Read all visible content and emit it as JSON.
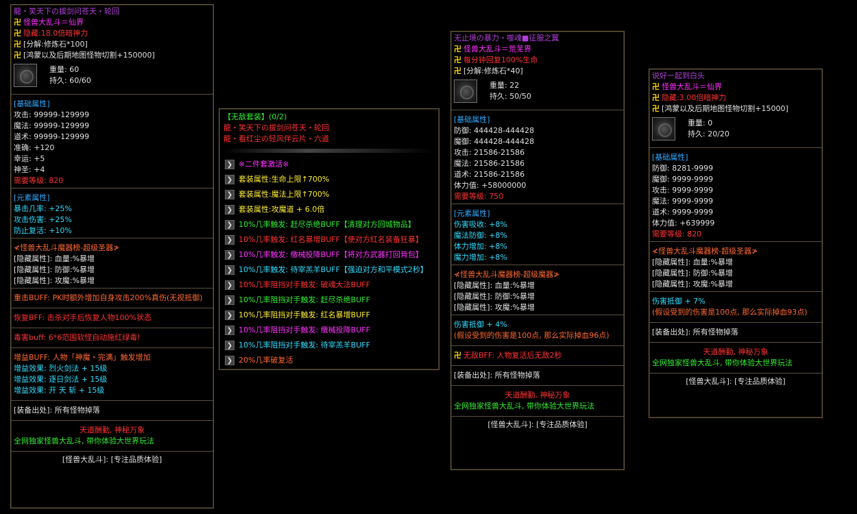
{
  "panel1": {
    "title": "龍・笑天下の拔剑问苍天・轮回",
    "head_rows": [
      {
        "sym": "卍",
        "text": "怪兽大乱斗＝仙界",
        "color": "c-mag"
      },
      {
        "sym": "卍",
        "text": "隐藏:18.0倍暗神力",
        "color": "c-red"
      },
      {
        "sym": "卍",
        "text": "[分解:修炼石*100]",
        "color": "c-white"
      },
      {
        "sym": "卍",
        "text": "[鸿蒙以及后期地图怪物切割+150000]",
        "color": "c-white"
      }
    ],
    "weight": "重量: 60",
    "durability": "持久: 60/60",
    "base_header": "[基础属性]",
    "base_rows": [
      "攻击: 99999-129999",
      "魔法: 99999-129999",
      "道术: 99999-129999",
      "准确: +120",
      "幸运: +5",
      "神圣: +4"
    ],
    "level_req": "需要等级: 820",
    "elem_header": "[元素属性]",
    "elem_rows": [
      "暴击几率: +25%",
      "攻击伤害: +25%",
      "防止复活: +10%"
    ],
    "saint_title": "≮怪兽大乱斗魔器榜-超级圣器≯",
    "hidden_rows": [
      "[隐藏属性]: 血量:%暴增",
      "[隐藏属性]: 防御:%暴增",
      "[隐藏属性]: 攻魔:%暴增"
    ],
    "buff1": "重击BUFF: PK时额外增加自身攻击200%真伤(无视抵御)",
    "buff2": "恢复BFF: 击杀对手后恢复人物100%状态",
    "buff3": "毒害buff: 6*6范围软怪自动施红绿毒!",
    "gain_title": "增益BUFF: 人物「神魔・完满」触发增加",
    "gain_rows": [
      "增益效果: 烈火剑法 + 15级",
      "增益效果: 逐日剑法 + 15级",
      "增益效果: 开 天 斩 + 15级"
    ],
    "source": "[装备出处]: 所有怪物掉落",
    "slogan1": "天道酬勤, 神秘万象",
    "slogan2": "全网独家怪兽大乱斗, 带你体验大世界玩法",
    "footer": "[怪兽大乱斗]: [专注品质体验]"
  },
  "panel2": {
    "set_title": "【无敌套装】(0/2)",
    "set_items": [
      "龍・笑天下の拔剑问苍天・轮回",
      "龍・看红尘の轻风伴云片・六道"
    ],
    "rows": [
      {
        "text": "※二件套激活※",
        "color": "c-mag"
      },
      {
        "text": "套装属性:生命上限↑700%",
        "color": "c-yellow"
      },
      {
        "text": "套装属性:魔法上限↑700%",
        "color": "c-yellow"
      },
      {
        "text": "套装属性:攻魔道 + 6.0倍",
        "color": "c-yellow"
      },
      {
        "text": "10%几率触发: 赶尽杀绝BUFF【清理对方回城物品】",
        "color": "c-green"
      },
      {
        "text": "10%几率触发: 红名暴增BUFF【使对方红名装备狂暴】",
        "color": "c-red"
      },
      {
        "text": "10%几率触发: 缴械投降BUFF【将对方武器打回背包】",
        "color": "c-mag"
      },
      {
        "text": "10%几率触发: 待宰羔羊BUFF【强迫对方和平模式2秒】",
        "color": "c-cyan"
      },
      {
        "text": "10%几率阻挡对手触发: 破魂大法BUFF",
        "color": "c-red"
      },
      {
        "text": "10%几率阻挡对手触发: 赶尽杀绝BUFF",
        "color": "c-green"
      },
      {
        "text": "10%几率阻挡对手触发: 红名暴增BUFF",
        "color": "c-yellow"
      },
      {
        "text": "10%几率阻挡对手触发: 缴械投降BUFF",
        "color": "c-mag"
      },
      {
        "text": "10%几率阻挡对手触发: 待宰羔羊BUFF",
        "color": "c-cyan"
      },
      {
        "text": "20%几率破复活",
        "color": "c-orange"
      }
    ]
  },
  "panel3": {
    "title": "无止境の暴力・噬魂■征服之翼",
    "head_rows": [
      {
        "sym": "卍",
        "text": "怪兽大乱斗＝荒芜界",
        "color": "c-mag"
      },
      {
        "sym": "卍",
        "text": "每分钟回复100%生命",
        "color": "c-red"
      },
      {
        "sym": "卍",
        "text": "[分解:修炼石*40]",
        "color": "c-white"
      }
    ],
    "weight": "重量: 22",
    "durability": "持久: 50/50",
    "base_header": "[基础属性]",
    "base_rows": [
      "防御: 444428-444428",
      "魔御: 444428-444428",
      "攻击: 21586-21586",
      "魔法: 21586-21586",
      "道术: 21586-21586",
      "体力值: +58000000"
    ],
    "level_req": "需要等级: 750",
    "elem_header": "[元素属性]",
    "elem_rows": [
      "伤害吸收: +8%",
      "魔法防御: +8%",
      "体力增加: +8%",
      "魔力增加: +8%"
    ],
    "saint_title": "≮怪兽大乱斗魔器榜-超级魔器≯",
    "hidden_rows": [
      "[隐藏属性]: 血量:%暴增",
      "[隐藏属性]: 防御:%暴增",
      "[隐藏属性]: 攻魔:%暴增"
    ],
    "resist": "伤害抵御 + 4%",
    "resist_note": "(假设受到的伤害是100点, 那么实际掉血96点)",
    "invincible_sym": "卍",
    "invincible": "无敌BFF: 人物复活后无敌2秒",
    "source": "[装备出处]: 所有怪物掉落",
    "slogan1": "天道酬勤, 神秘万象",
    "slogan2": "全网独家怪兽大乱斗, 带你体验大世界玩法",
    "footer": "[怪兽大乱斗]: [专注品质体验]"
  },
  "panel4": {
    "title": "说好一起到白头",
    "head_rows": [
      {
        "sym": "卍",
        "text": "怪兽大乱斗＝仙界",
        "color": "c-mag"
      },
      {
        "sym": "卍",
        "text": "隐藏:3.00倍暗神力",
        "color": "c-red"
      },
      {
        "sym": "卍",
        "text": "[鸿蒙以及后期地图怪物切割+15000]",
        "color": "c-white"
      }
    ],
    "weight": "重量: 0",
    "durability": "持久: 20/20",
    "base_header": "[基础属性]",
    "base_rows": [
      "防御: 8281-9999",
      "魔御: 9999-9999",
      "攻击: 9999-9999",
      "魔法: 9999-9999",
      "道术: 9999-9999",
      "体力值: +639999"
    ],
    "level_req": "需要等级: 820",
    "saint_title": "≮怪兽大乱斗魔器榜-超级圣器≯",
    "hidden_rows": [
      "[隐藏属性]: 血量:%暴增",
      "[隐藏属性]: 防御:%暴增",
      "[隐藏属性]: 攻魔:%暴增"
    ],
    "resist": "伤害抵御 + 7%",
    "resist_note": "(假设受到的伤害是100点, 那么实际掉血93点)",
    "source": "[装备出处]: 所有怪物掉落",
    "slogan1": "天道酬勤, 神秘万象",
    "slogan2": "全网独家怪兽大乱斗, 带你体验大世界玩法",
    "footer": "[怪兽大乱斗]: [专注品质体验]"
  }
}
